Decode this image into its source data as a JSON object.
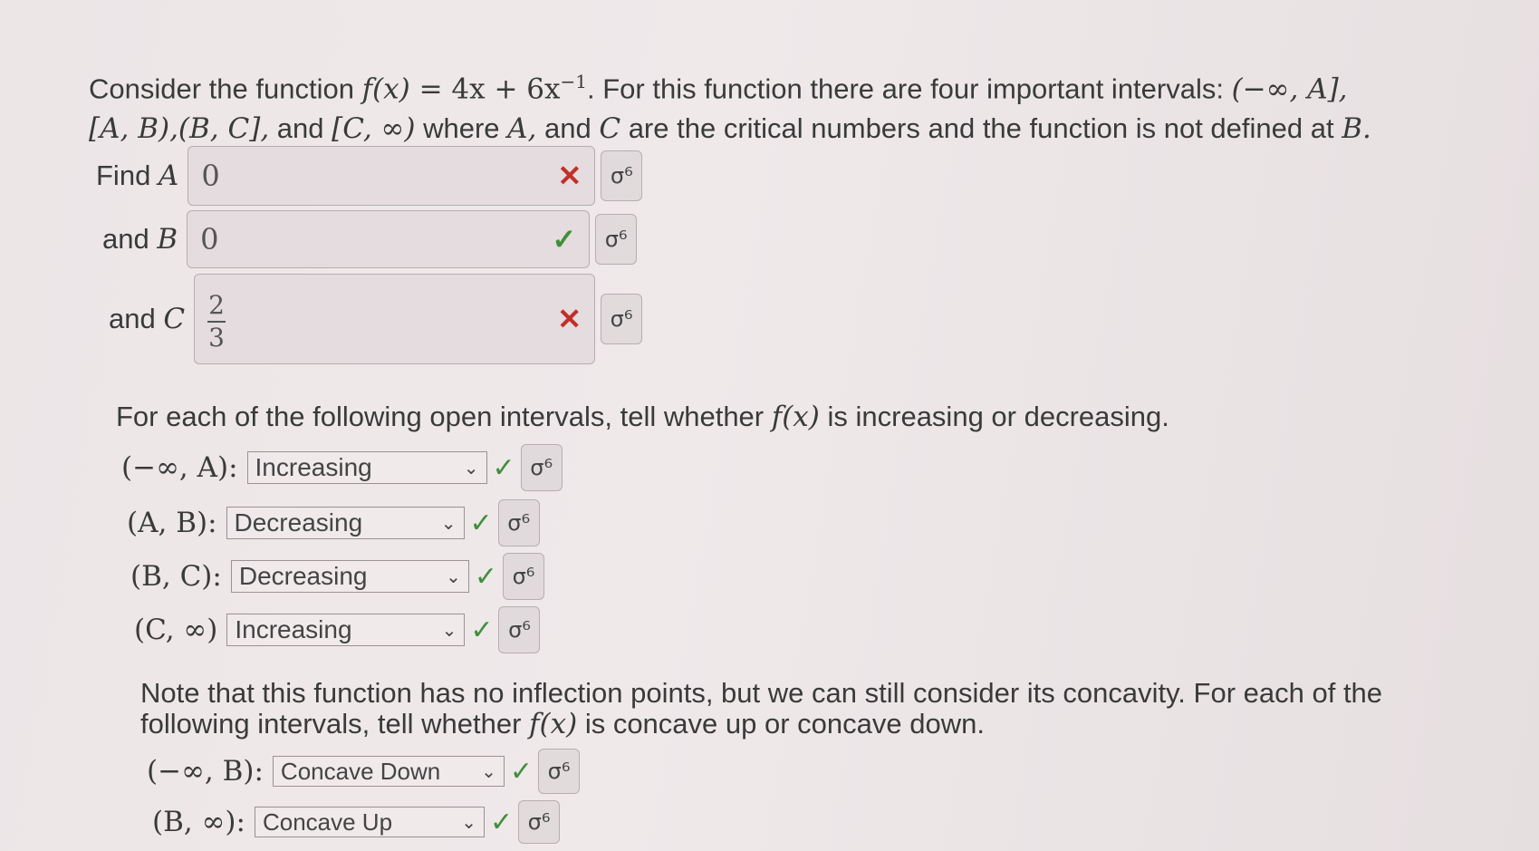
{
  "intro": {
    "line1_a": "Consider the function ",
    "line1_fx": "f(x)",
    "line1_eq": " = 4x + 6x",
    "line1_exp": "−1",
    "line1_b": ". For this function there are four important intervals: ",
    "line1_int": "(−∞, A],",
    "line2_int1": "[A, B),(B, C],",
    "line2_and": " and ",
    "line2_int2": "[C, ∞)",
    "line2_b": " where ",
    "line2_A": "A,",
    "line2_c": " and ",
    "line2_C": "C",
    "line2_d": " are the critical numbers and the function is not defined at ",
    "line2_B": "B."
  },
  "inputs": [
    {
      "label_text": "Find ",
      "label_var": "A",
      "value": "0",
      "status": "✕",
      "key_icon": "σ⁶"
    },
    {
      "label_text": "and ",
      "label_var": "B",
      "value": "0",
      "status": "✓",
      "key_icon": "σ⁶"
    },
    {
      "label_text": "and ",
      "label_var": "C",
      "num": "2",
      "den": "3",
      "status": "✕",
      "key_icon": "σ⁶"
    }
  ],
  "increasing": {
    "prompt_a": "For each of the following open intervals, tell whether ",
    "prompt_fx": "f(x)",
    "prompt_b": " is increasing or decreasing.",
    "rows": [
      {
        "interval": "(−∞, A):",
        "value": "Increasing",
        "check": "✓",
        "key_icon": "σ⁶"
      },
      {
        "interval": "(A, B):",
        "value": "Decreasing",
        "check": "✓",
        "key_icon": "σ⁶"
      },
      {
        "interval": "(B, C):",
        "value": "Decreasing",
        "check": "✓",
        "key_icon": "σ⁶"
      },
      {
        "interval": "(C, ∞)",
        "value": "Increasing",
        "check": "✓",
        "key_icon": "σ⁶"
      }
    ]
  },
  "concavity": {
    "prompt_a": "Note that this function has no inflection points, but we can still consider its concavity. For each of the",
    "prompt_b": "following intervals, tell whether ",
    "prompt_fx": "f(x)",
    "prompt_c": " is concave up or concave down.",
    "rows": [
      {
        "interval": "(−∞, B):",
        "value": "Concave Down",
        "check": "✓",
        "key_icon": "σ⁶"
      },
      {
        "interval": "(B, ∞):",
        "value": "Concave Up",
        "check": "✓",
        "key_icon": "σ⁶"
      }
    ]
  },
  "colors": {
    "wrong": "#c0302a",
    "right": "#3f8f3a"
  }
}
